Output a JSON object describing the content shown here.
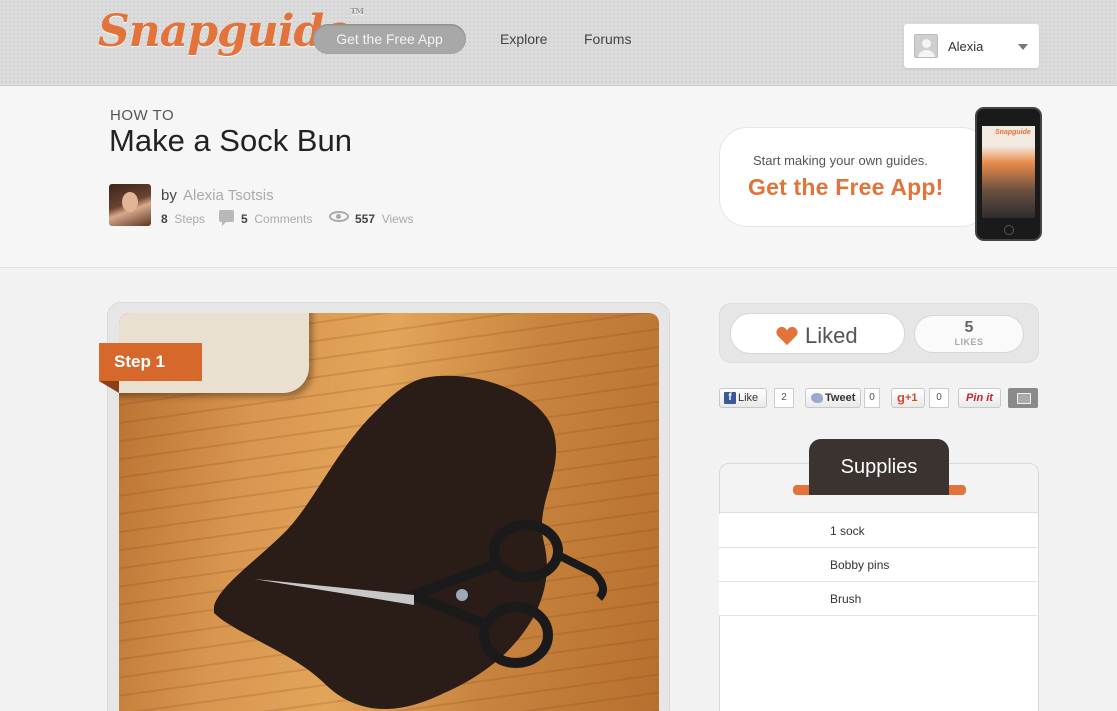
{
  "header": {
    "logo": "Snapguide",
    "logo_tm": "TM",
    "free_app_button": "Get the Free App",
    "nav": [
      "Explore",
      "Forums"
    ],
    "user_name": "Alexia"
  },
  "guide": {
    "kicker": "HOW TO",
    "title": "Make a Sock Bun",
    "by": "by",
    "author": "Alexia Tsotsis",
    "steps_count": "8",
    "steps_label": "Steps",
    "comments_count": "5",
    "comments_label": "Comments",
    "views_count": "557",
    "views_label": "Views"
  },
  "promo": {
    "small_text": "Start making your own guides.",
    "big_text": "Get the Free App!",
    "phone_logo": "Snapguide"
  },
  "step": {
    "badge": "Step 1"
  },
  "likes": {
    "button_label": "Liked",
    "count": "5",
    "count_label": "LIKES"
  },
  "share": {
    "facebook_label": "Like",
    "facebook_count": "2",
    "tweet_label": "Tweet",
    "tweet_count": "0",
    "gplus_label": "+1",
    "gplus_count": "0",
    "pinit_label": "Pin it"
  },
  "supplies": {
    "title": "Supplies",
    "items": [
      "1 sock",
      "Bobby pins",
      "Brush"
    ]
  },
  "colors": {
    "accent": "#e2733a",
    "dark_tab": "#3a3330"
  }
}
